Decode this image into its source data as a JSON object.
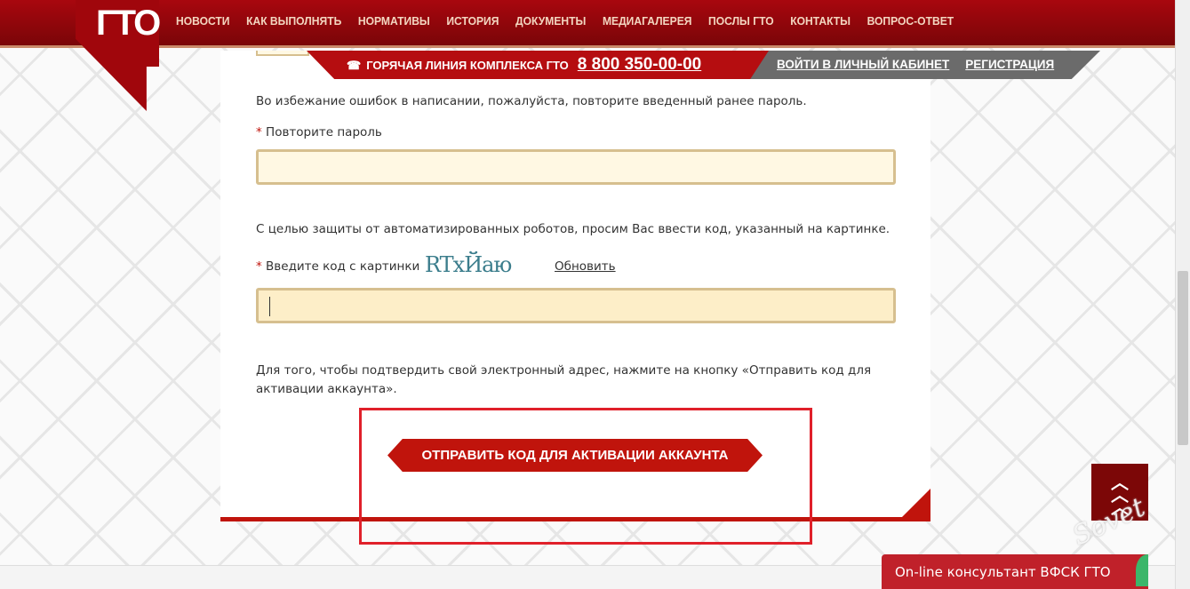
{
  "header": {
    "logo": "ГТО",
    "nav": [
      "НОВОСТИ",
      "КАК ВЫПОЛНЯТЬ",
      "НОРМАТИВЫ",
      "ИСТОРИЯ",
      "ДОКУМЕНТЫ",
      "МЕДИАГАЛЕРЕЯ",
      "ПОСЛЫ ГТО",
      "КОНТАКТЫ",
      "ВОПРОС-ОТВЕТ"
    ],
    "hotline_label": "ГОРЯЧАЯ ЛИНИЯ КОМПЛЕКСА ГТО",
    "hotline_number": "8 800 350-00-00",
    "login": "ВОЙТИ В ЛИЧНЫЙ КАБИНЕТ",
    "register": "РЕГИСТРАЦИЯ"
  },
  "form": {
    "repeat_hint": "Во избежание ошибок в написании, пожалуйста, повторите введенный ранее пароль.",
    "repeat_label": "Повторите пароль",
    "repeat_value": "",
    "captcha_hint": "С целью защиты от автоматизированных роботов, просим Вас ввести код, указанный на картинке.",
    "captcha_label": "Введите код с картинки",
    "captcha_image_text": "RTxЙаю",
    "refresh": "Обновить",
    "captcha_value": "",
    "confirm_hint_1": "Для того, чтобы подтвердить свой электронный адрес, нажмите на кнопку «Отправить код для",
    "confirm_hint_2": "активации аккаунта».",
    "submit": "ОТПРАВИТЬ КОД ДЛЯ АКТИВАЦИИ АККАУНТА",
    "required_mark": "*"
  },
  "consultant": "On-line консультант ВФСК ГТО",
  "watermark": "club Sovet",
  "colors": {
    "brand_red": "#a8070e",
    "button_red": "#c0140c",
    "field_bg": "#fff8e3",
    "highlight": "#e0202a"
  }
}
